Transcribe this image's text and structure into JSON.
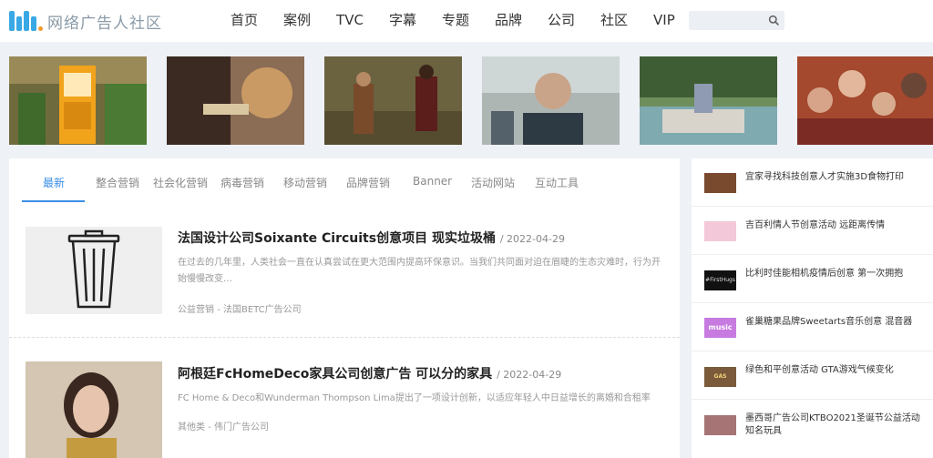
{
  "header": {
    "logo_text": "网络广告人社区",
    "nav": [
      "首页",
      "案例",
      "TVC",
      "字幕",
      "专题",
      "品牌",
      "公司",
      "社区",
      "VIP"
    ],
    "search_placeholder": ""
  },
  "tabs": [
    "最新",
    "整合营销",
    "社会化营销",
    "病毒营销",
    "移动营销",
    "品牌营销",
    "Banner",
    "活动网站",
    "互动工具"
  ],
  "articles": [
    {
      "title": "法国设计公司Soixante Circuits创意项目 现实垃圾桶",
      "date": "/ 2022-04-29",
      "desc": "在过去的几年里，人类社会一直在认真尝试在更大范围内提高环保意识。当我们共同面对迫在眉睫的生态灾难时，行为开始慢慢改变…",
      "category": "公益营销",
      "company": "- 法国BETC广告公司"
    },
    {
      "title": "阿根廷FcHomeDeco家具公司创意广告 可以分的家具",
      "date": "/ 2022-04-29",
      "desc": "FC Home & Deco和Wunderman Thompson Lima提出了一项设计创新，以适应年轻人中日益增长的离婚和合租率",
      "category": "其他类",
      "company": "- 伟门广告公司"
    }
  ],
  "sidebar": [
    {
      "text": "宜家寻找科技创意人才实施3D食物打印",
      "thumb_label": ""
    },
    {
      "text": "吉百利情人节创意活动 远距离传情",
      "thumb_label": ""
    },
    {
      "text": "比利时佳能相机疫情后创意 第一次拥抱",
      "thumb_label": "#FirstHugs"
    },
    {
      "text": "雀巢糖果品牌Sweetarts音乐创意 混音器",
      "thumb_label": "music"
    },
    {
      "text": "绿色和平创意活动 GTA游戏气候变化",
      "thumb_label": "GAS SMOG"
    },
    {
      "text": "墨西哥广告公司KTBO2021圣诞节公益活动 知名玩具",
      "thumb_label": ""
    }
  ],
  "colors": {
    "accent": "#3a8ee6",
    "logo": "#39a8e5",
    "page_bg": "#eef1f6"
  }
}
